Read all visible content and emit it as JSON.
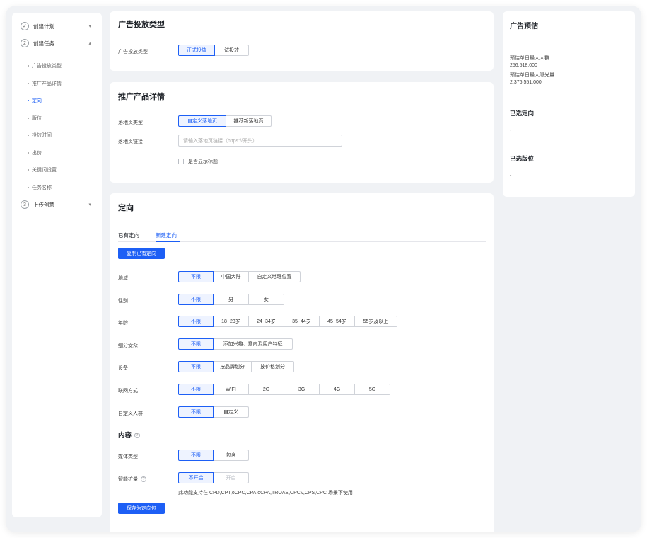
{
  "nav": {
    "steps": [
      {
        "num": "✓",
        "label": "创建计划",
        "chevron": "▾"
      },
      {
        "num": "2",
        "label": "创建任务",
        "chevron": "▴"
      },
      {
        "num": "3",
        "label": "上传创意",
        "chevron": "▾"
      }
    ],
    "subs": [
      "广告投放类型",
      "推广产品详情",
      "定向",
      "版位",
      "投放时间",
      "出价",
      "关键词设置",
      "任务名称"
    ]
  },
  "ad_type": {
    "title": "广告投放类型",
    "label": "广告投放类型",
    "options": [
      "正式投放",
      "试投放"
    ]
  },
  "product": {
    "title": "推广产品详情",
    "landing_type_label": "落地页类型",
    "landing_options": [
      "自定义落地页",
      "推荐新落地页"
    ],
    "landing_link_label": "落地页链接",
    "landing_link_placeholder": "请输入落地页链接（https://开头）",
    "show_title_label": "是否显示标题"
  },
  "targeting": {
    "title": "定向",
    "tabs": [
      "已有定向",
      "新建定向"
    ],
    "copy_button": "复制已有定向",
    "rows": [
      {
        "label": "地域",
        "options": [
          "不限",
          "中国大陆",
          "自定义地理位置"
        ]
      },
      {
        "label": "性别",
        "options": [
          "不限",
          "男",
          "女"
        ]
      },
      {
        "label": "年龄",
        "options": [
          "不限",
          "18~23岁",
          "24~34岁",
          "35~44岁",
          "45~54岁",
          "55岁及以上"
        ]
      },
      {
        "label": "细分受众",
        "options": [
          "不限",
          "添加兴趣、意向及用户特征"
        ]
      },
      {
        "label": "设备",
        "options": [
          "不限",
          "按品牌划分",
          "按价格划分"
        ]
      },
      {
        "label": "联网方式",
        "options": [
          "不限",
          "WIFI",
          "2G",
          "3G",
          "4G",
          "5G"
        ]
      },
      {
        "label": "自定义人群",
        "options": [
          "不限",
          "自定义"
        ]
      }
    ],
    "content_title": "内容",
    "media_label": "媒体类型",
    "media_options": [
      "不限",
      "包含"
    ],
    "smart_label": "智能扩量",
    "smart_options": [
      "不开启",
      "开启"
    ],
    "smart_note": "此功能支持在 CPD,CPT,oCPC,CPA,oCPA,TROAS,CPCV,CPS,CPC 场景下使用",
    "save_button": "保存为定向包"
  },
  "estimate": {
    "title": "广告预估",
    "max_people_label": "预估单日最大人群",
    "max_people_value": "256,518,000",
    "max_exposure_label": "预估单日最大曝光量",
    "max_exposure_value": "2,376,551,000",
    "selected_targeting_title": "已选定向",
    "selected_targeting_value": "-",
    "selected_slots_title": "已选版位",
    "selected_slots_value": "-"
  },
  "colors": {
    "accent": "#1d5ff5",
    "page_bg": "#f0f2f5"
  }
}
